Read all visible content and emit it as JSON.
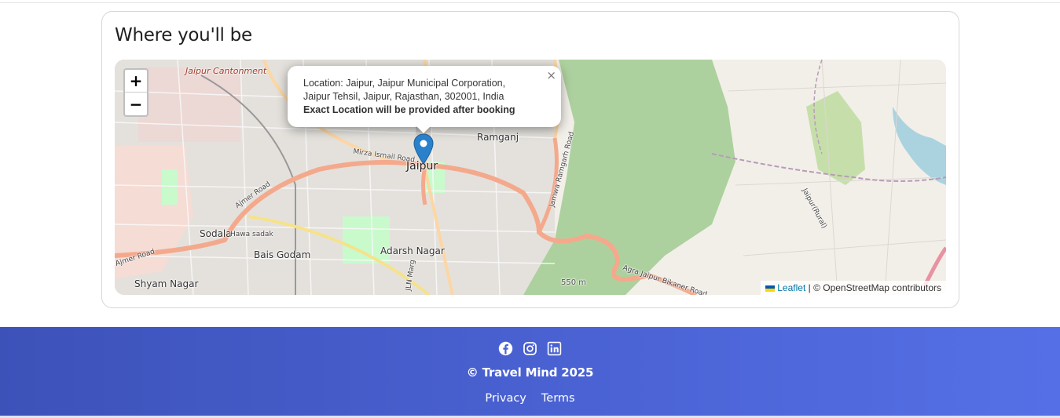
{
  "section": {
    "title": "Where you'll be"
  },
  "map": {
    "zoom_in_label": "+",
    "zoom_out_label": "−",
    "popup": {
      "location_line1": "Location: Jaipur, Jaipur Municipal Corporation,",
      "location_line2": "Jaipur Tehsil, Jaipur, Rajasthan, 302001, India",
      "notice": "Exact Location will be provided after booking",
      "close_label": "×"
    },
    "places": {
      "jaipur": "Jaipur",
      "ramganj": "Ramganj",
      "cantonment": "Jaipur Cantonment",
      "sodala": "Sodala",
      "bais_godam": "Bais Godam",
      "adarsh_nagar": "Adarsh Nagar",
      "shyam_nagar": "Shyam Nagar",
      "mirza_ismail_road": "Mirza Ismail Road",
      "ajmer_road": "Ajmer Road",
      "ajmer_road_2": "Ajmer Road",
      "hawa_sadak": "Hawa sadak",
      "jln_marg": "JLN Marg",
      "jamwa_ramgarh_road": "Jamwa Ramgarh Road",
      "agra_jaipur_bikaner_road": "Agra Jaipur Bikaner Road",
      "jaipur_rural": "Jaipur(Rural)",
      "scale": "550 m"
    },
    "attribution": {
      "leaflet": "Leaflet",
      "separator": " | © OpenStreetMap contributors"
    },
    "colors": {
      "water": "#aad3df",
      "forest": "#add19e",
      "major_road": "#f4a98c",
      "trunk_road": "#fcd6a4",
      "built_up": "#e0dfdf"
    }
  },
  "footer": {
    "icons": [
      "facebook-icon",
      "instagram-icon",
      "linkedin-icon"
    ],
    "copyright": "© Travel Mind 2025",
    "links": [
      "Privacy",
      "Terms"
    ],
    "gradient": [
      "#3d52b9",
      "#5570e6"
    ]
  }
}
